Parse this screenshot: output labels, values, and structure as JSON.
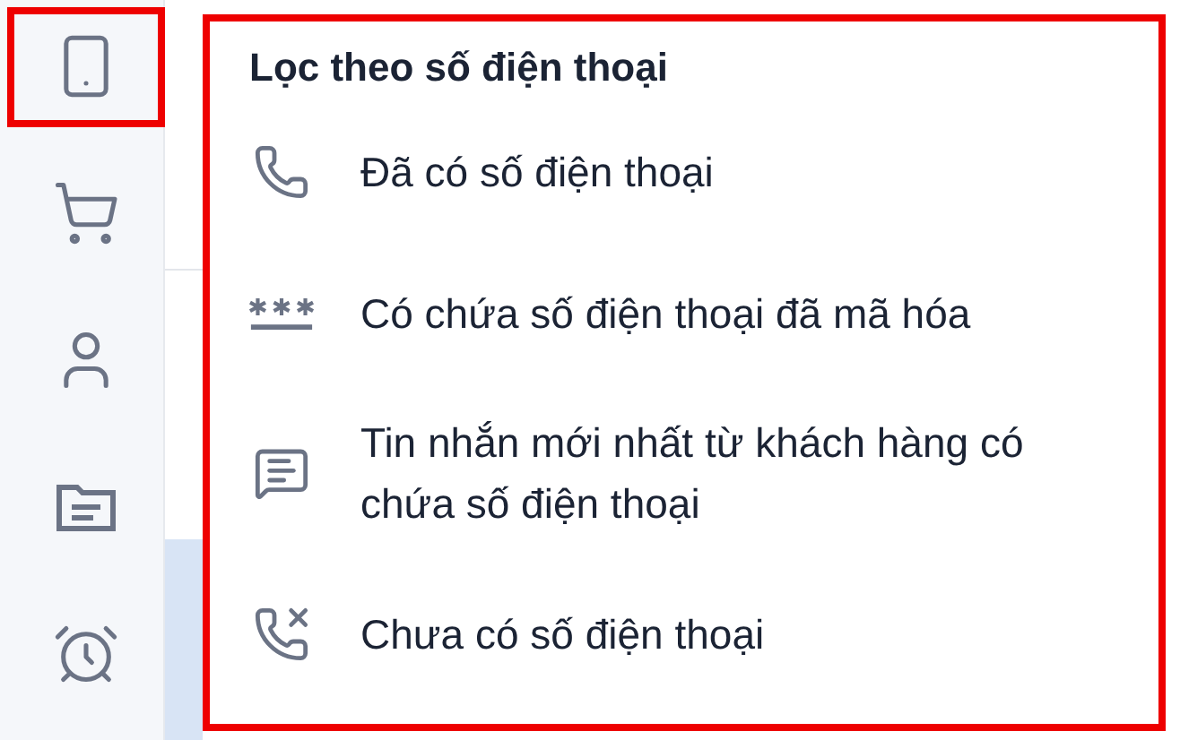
{
  "sidebar": {
    "items": [
      {
        "kind": "phone",
        "highlighted": true
      },
      {
        "kind": "cart",
        "highlighted": false
      },
      {
        "kind": "person",
        "highlighted": false
      },
      {
        "kind": "folder",
        "highlighted": false
      },
      {
        "kind": "alarm",
        "highlighted": false
      }
    ]
  },
  "filter_menu": {
    "title": "Lọc theo số điện thoại",
    "highlighted": true,
    "items": [
      {
        "kind": "phone",
        "label": "Đã có số điện thoại"
      },
      {
        "kind": "masked",
        "label": "Có chứa số điện thoại đã mã hóa"
      },
      {
        "kind": "message",
        "label": "Tin nhắn mới nhất từ khách hàng có chứa số điện thoại"
      },
      {
        "kind": "no-phone",
        "label": "Chưa có số điện thoại"
      }
    ]
  }
}
